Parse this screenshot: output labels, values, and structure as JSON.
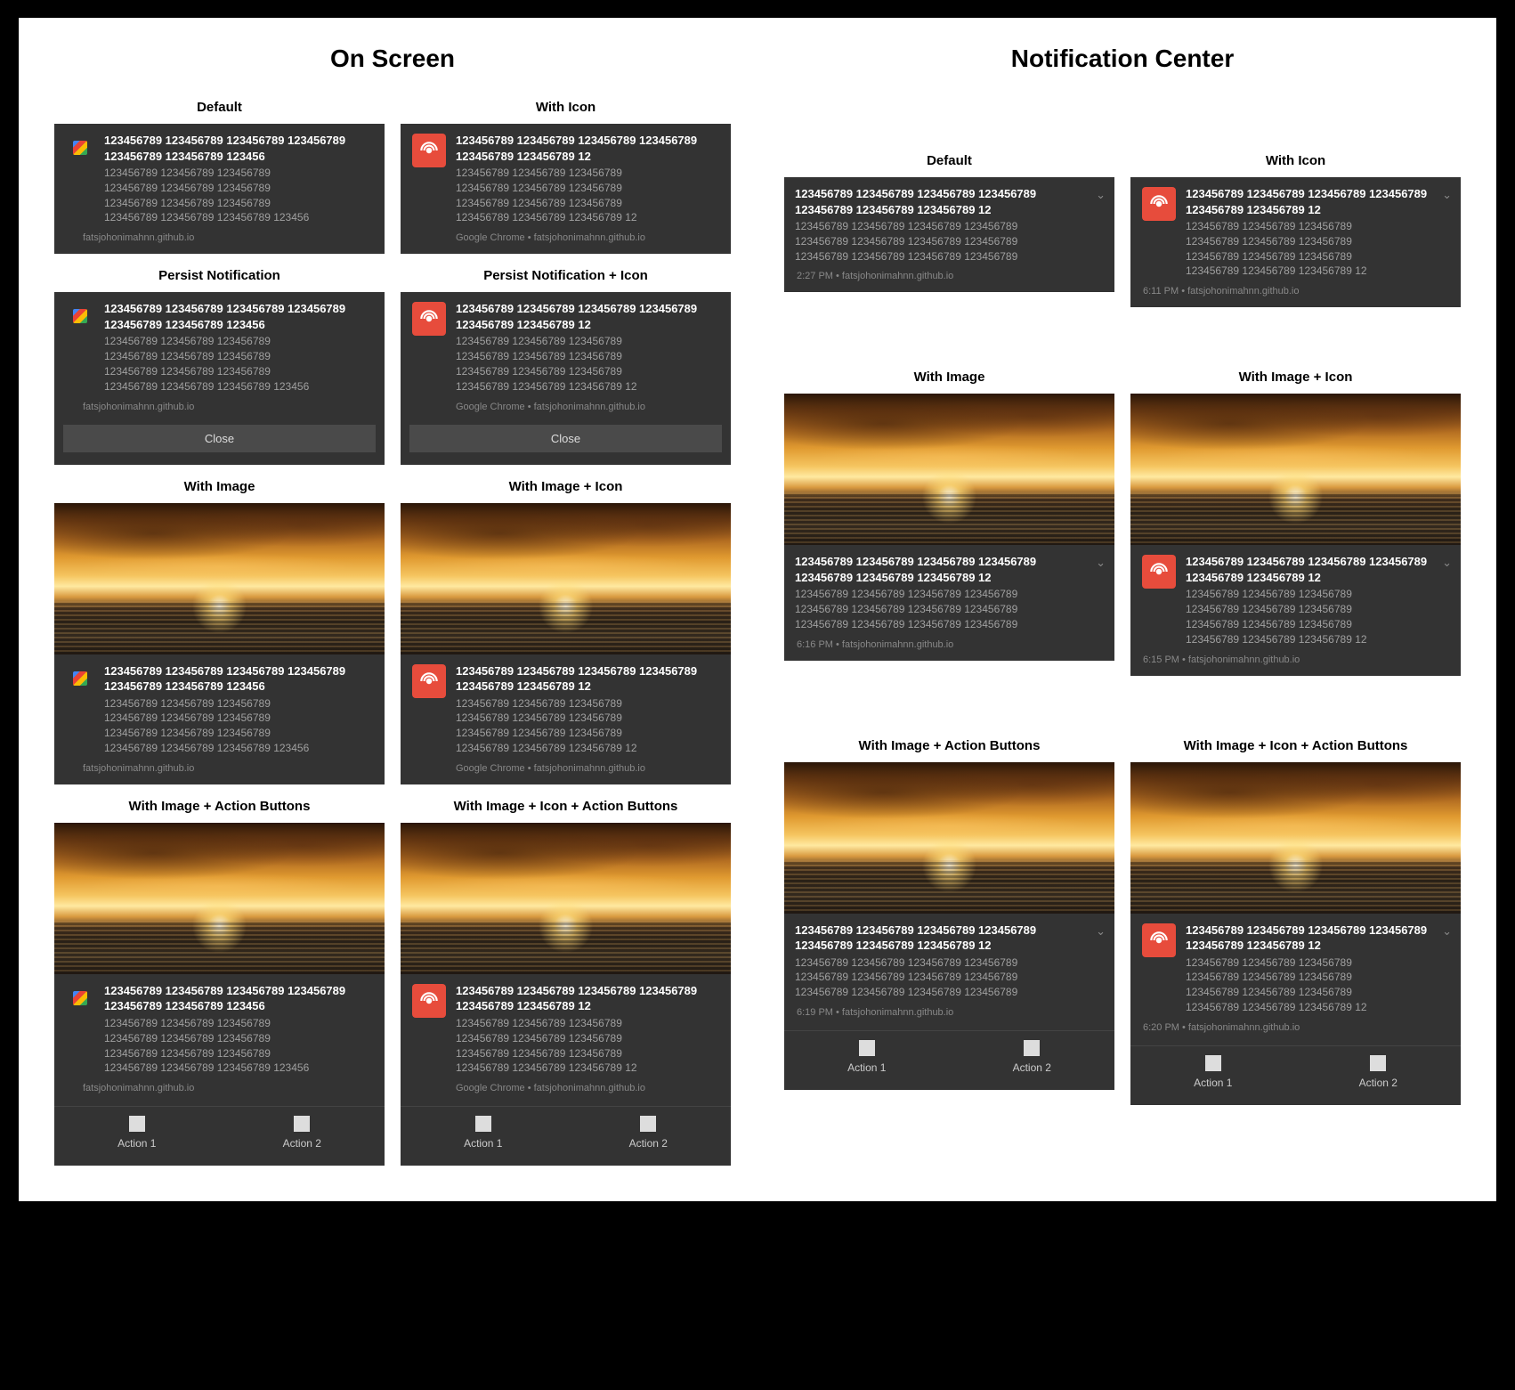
{
  "headings": {
    "on_screen": "On Screen",
    "notification_center": "Notification Center"
  },
  "labels": {
    "default": "Default",
    "with_icon": "With Icon",
    "persist": "Persist Notification",
    "persist_icon": "Persist Notification + Icon",
    "with_image": "With Image",
    "with_image_icon": "With Image + Icon",
    "with_image_actions": "With Image + Action Buttons",
    "with_image_icon_actions": "With Image + Icon + Action Buttons"
  },
  "text": {
    "title_a": "123456789 123456789 123456789 123456789 123456789 123456789 123456",
    "title_b": "123456789 123456789 123456789 123456789 123456789 123456789 12",
    "title_nc_a": "123456789 123456789 123456789 123456789 123456789 123456789 123456789 12",
    "title_nc_b": "123456789 123456789 123456789 123456789 123456789 123456789 12",
    "body_a": "123456789 123456789 123456789\n123456789 123456789 123456789\n123456789 123456789 123456789\n123456789 123456789 123456789 123456",
    "body_b": "123456789 123456789 123456789\n123456789 123456789 123456789\n123456789 123456789 123456789\n123456789 123456789 123456789 12",
    "body_nc_a": "123456789 123456789 123456789 123456789\n123456789 123456789 123456789 123456789\n123456789 123456789 123456789 123456789",
    "body_nc_b": "123456789 123456789 123456789\n123456789 123456789 123456789\n123456789 123456789 123456789\n123456789 123456789 123456789 12"
  },
  "source": {
    "plain": "fatsjohonimahnn.github.io",
    "chrome": "Google Chrome • fatsjohonimahnn.github.io"
  },
  "nc_times": {
    "default": "2:27 PM • fatsjohonimahnn.github.io",
    "with_icon": "6:11 PM • fatsjohonimahnn.github.io",
    "with_image": "6:16 PM • fatsjohonimahnn.github.io",
    "with_image_icon": "6:15 PM • fatsjohonimahnn.github.io",
    "with_image_actions": "6:19 PM • fatsjohonimahnn.github.io",
    "with_image_icon_actions": "6:20 PM • fatsjohonimahnn.github.io"
  },
  "buttons": {
    "close": "Close",
    "action1": "Action 1",
    "action2": "Action 2"
  }
}
